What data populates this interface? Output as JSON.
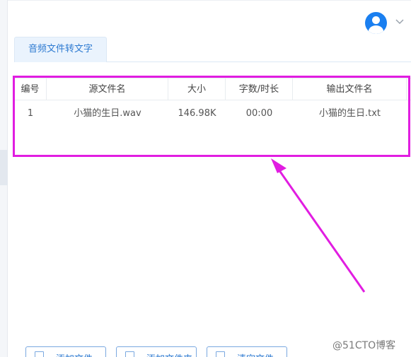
{
  "header": {
    "avatar_icon": "user-avatar-icon",
    "menu_icon": "chevron-down-icon",
    "accent": "#1a7ff0"
  },
  "tabs": [
    {
      "label": "音频文件转文字",
      "active": true
    }
  ],
  "table": {
    "columns": [
      "编号",
      "源文件名",
      "大小",
      "字数/时长",
      "输出文件名"
    ],
    "rows": [
      [
        "1",
        "小猫的生日.wav",
        "146.98K",
        "00:00",
        "小猫的生日.txt"
      ]
    ]
  },
  "toolbar": {
    "buttons": [
      {
        "label": "添加文件",
        "icon": "file-icon"
      },
      {
        "label": "添加文件夹",
        "icon": "folder-icon"
      },
      {
        "label": "清空文件",
        "icon": "trash-icon"
      }
    ]
  },
  "annotation": {
    "color": "#e11de1",
    "watermark": "@51CTO博客"
  }
}
